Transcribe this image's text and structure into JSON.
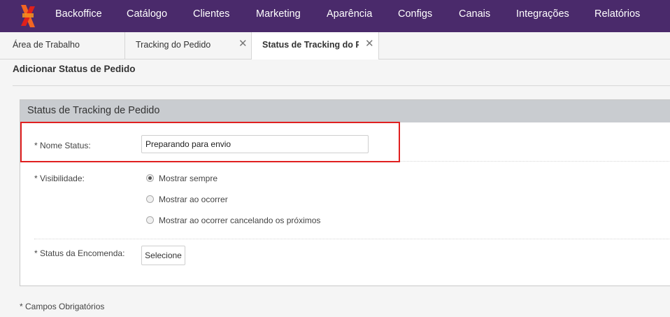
{
  "nav": {
    "logo_icon": "brand-x-logo",
    "items": [
      {
        "label": "Backoffice"
      },
      {
        "label": "Catálogo"
      },
      {
        "label": "Clientes"
      },
      {
        "label": "Marketing"
      },
      {
        "label": "Aparência"
      },
      {
        "label": "Configs"
      },
      {
        "label": "Canais"
      },
      {
        "label": "Integrações"
      },
      {
        "label": "Relatórios"
      }
    ]
  },
  "tabs": [
    {
      "label": "Área de Trabalho",
      "closable": false
    },
    {
      "label": "Tracking do Pedido",
      "closable": true,
      "close_glyph": "✕"
    },
    {
      "label": "Status de Tracking do Pedido",
      "closable": true,
      "active": true,
      "close_glyph": "✕"
    }
  ],
  "page": {
    "title": "Adicionar Status de Pedido"
  },
  "panel": {
    "header": "Status de Tracking de Pedido",
    "nome_status": {
      "label": "* Nome Status:",
      "value": "Preparando para envio"
    },
    "visibilidade": {
      "label": "* Visibilidade:",
      "options": [
        {
          "label": "Mostrar sempre",
          "checked": true
        },
        {
          "label": "Mostrar ao ocorrer",
          "checked": false
        },
        {
          "label": "Mostrar ao ocorrer cancelando os próximos",
          "checked": false
        }
      ]
    },
    "status_encomenda": {
      "label": "* Status da Encomenda:",
      "button": "Selecione"
    }
  },
  "footnote": "* Campos Obrigatórios",
  "colors": {
    "nav_bg": "#4a2a6b",
    "highlight": "#e02020",
    "panel_header_bg": "#c9ccd0",
    "logo_orange": "#f26522",
    "logo_red": "#e0201b"
  }
}
